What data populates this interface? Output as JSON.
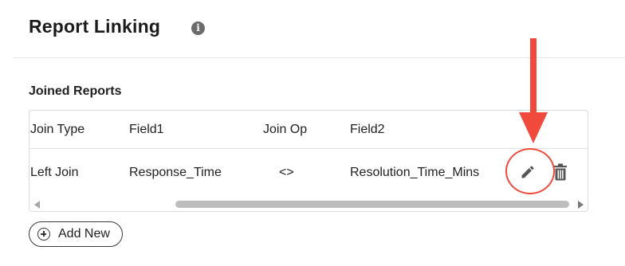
{
  "header": {
    "title": "Report Linking",
    "info_icon": "info-circle-icon"
  },
  "section": {
    "title": "Joined Reports"
  },
  "table": {
    "columns": [
      "Join Type",
      "Field1",
      "Join Op",
      "Field2"
    ],
    "rows": [
      {
        "join_type": "Left Join",
        "field1": "Response_Time",
        "join_op": "<>",
        "field2": "Resolution_Time_Mins",
        "actions": [
          "pencil-edit-icon",
          "trash-delete-icon"
        ]
      }
    ]
  },
  "add_button": {
    "label": "Add New",
    "icon": "plus-circle-icon"
  },
  "annotation": {
    "color": "#ef4a3c",
    "arrow": "down-arrow-icon",
    "circle_target": "edit-button"
  },
  "colors": {
    "text": "#1f1f1f",
    "border": "#dcdcdc",
    "scroll_thumb": "#bdbdbd",
    "annotation_red": "#ef4a3c"
  }
}
